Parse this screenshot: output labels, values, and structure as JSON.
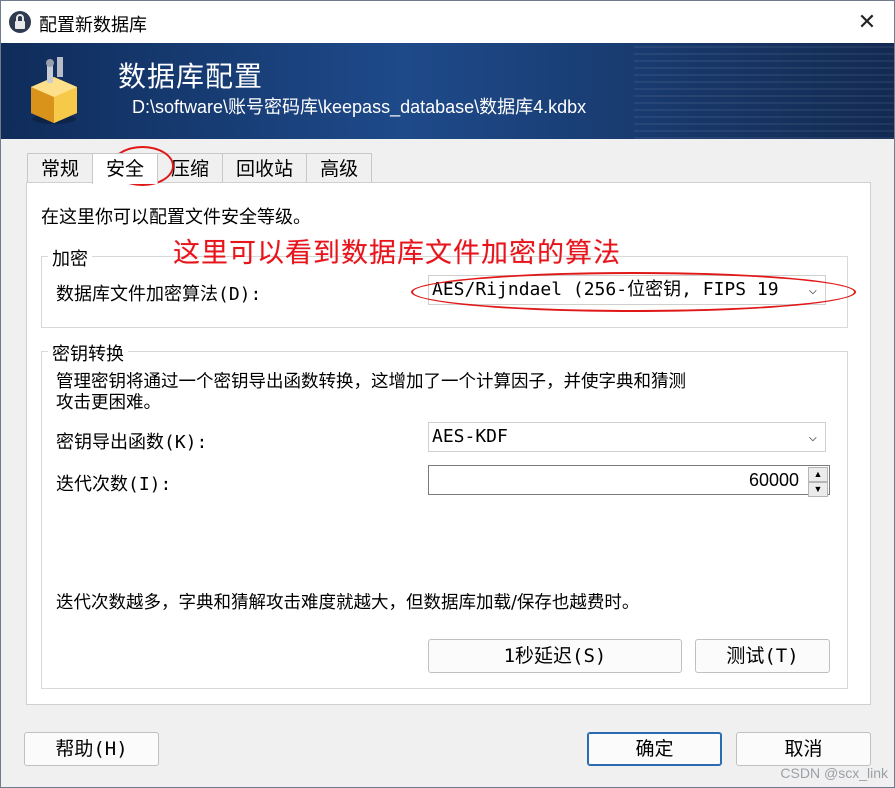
{
  "window": {
    "title": "配置新数据库",
    "close_glyph": "✕"
  },
  "banner": {
    "title": "数据库配置",
    "path": "D:\\software\\账号密码库\\keepass_database\\数据库4.kdbx"
  },
  "tabs": [
    {
      "label": "常规"
    },
    {
      "label": "安全"
    },
    {
      "label": "压缩"
    },
    {
      "label": "回收站"
    },
    {
      "label": "高级"
    }
  ],
  "security": {
    "intro": "在这里你可以配置文件安全等级。",
    "encryption": {
      "legend": "加密",
      "algorithm_label": "数据库文件加密算法(D):",
      "algorithm_value": "AES/Rijndael (256-位密钥, FIPS 19"
    },
    "key_transform": {
      "legend": "密钥转换",
      "description_line1": "管理密钥将通过一个密钥导出函数转换，这增加了一个计算因子，并使字典和猜测",
      "description_line2": "攻击更困难。",
      "kdf_label": "密钥导出函数(K):",
      "kdf_value": "AES-KDF",
      "iterations_label": "迭代次数(I):",
      "iterations_value": "60000",
      "hint": "迭代次数越多，字典和猜解攻击难度就越大，但数据库加载/保存也越费时。",
      "delay_button": "1秒延迟(S)",
      "test_button": "测试(T)"
    }
  },
  "annotation": "这里可以看到数据库文件加密的算法",
  "footer": {
    "help_button": "帮助(H)",
    "ok_button": "确定",
    "cancel_button": "取消"
  },
  "watermark": "CSDN @scx_link",
  "colors": {
    "banner": "#1e4a8a",
    "annotation": "#e8141c",
    "primary_border": "#2b6cb0"
  },
  "icons": {
    "app": "lock-icon",
    "banner": "database-box-icon",
    "close": "close-icon",
    "dropdown": "chevron-down-icon"
  }
}
